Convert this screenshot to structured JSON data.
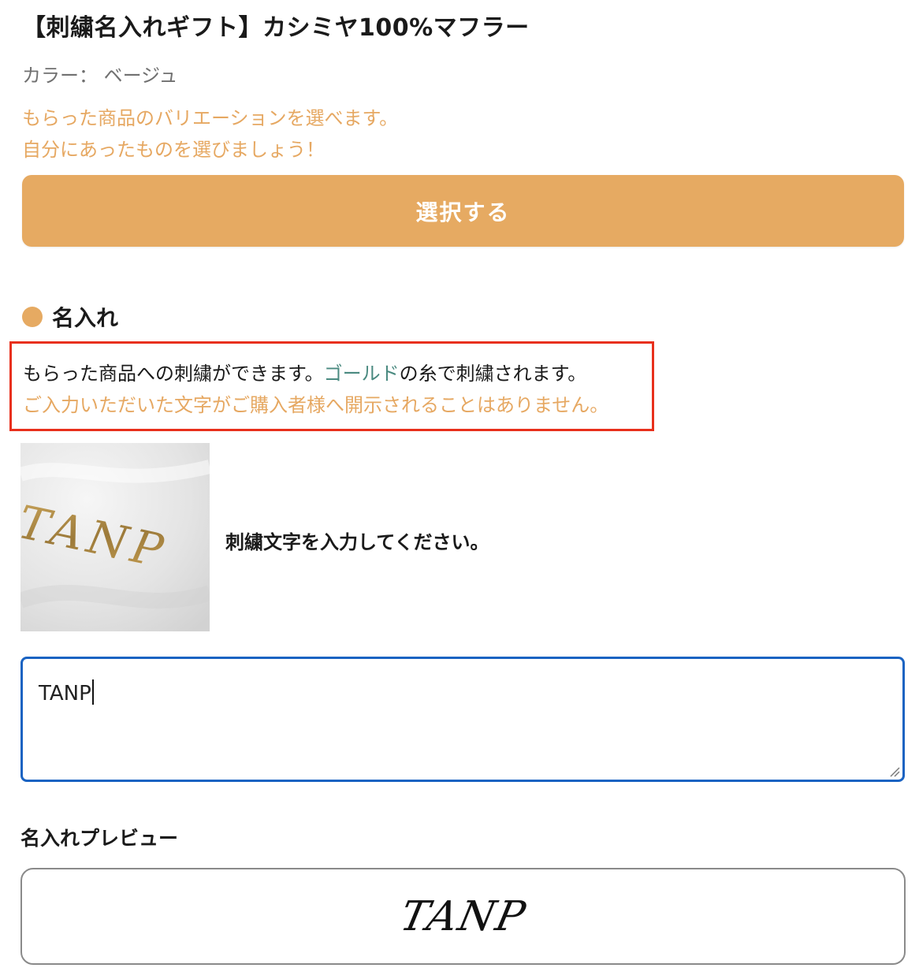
{
  "product": {
    "title": "【刺繍名入れギフト】カシミヤ100%マフラー",
    "color_label": "カラー：",
    "color_value": "ベージュ"
  },
  "variation": {
    "note_line1": "もらった商品のバリエーションを選べます。",
    "note_line2": "自分にあったものを選びましょう！",
    "select_label": "選択する"
  },
  "naming": {
    "heading": "名入れ",
    "notice_part1": "もらった商品への刺繍ができます。",
    "notice_gold": "ゴールド",
    "notice_part2": "の糸で刺繍されます。",
    "notice_line2": "ご入力いただいた文字がご購入者様へ開示されることはありません。",
    "sample_text": "TANP",
    "instruction": "刺繍文字を入力してください。",
    "input_value": "TANP"
  },
  "preview": {
    "heading": "名入れプレビュー",
    "text": "TANP"
  },
  "colors": {
    "accent": "#e6aa62",
    "highlight_border": "#e8301c",
    "focus_border": "#1a63c2",
    "gold_word": "#4a8a80"
  }
}
